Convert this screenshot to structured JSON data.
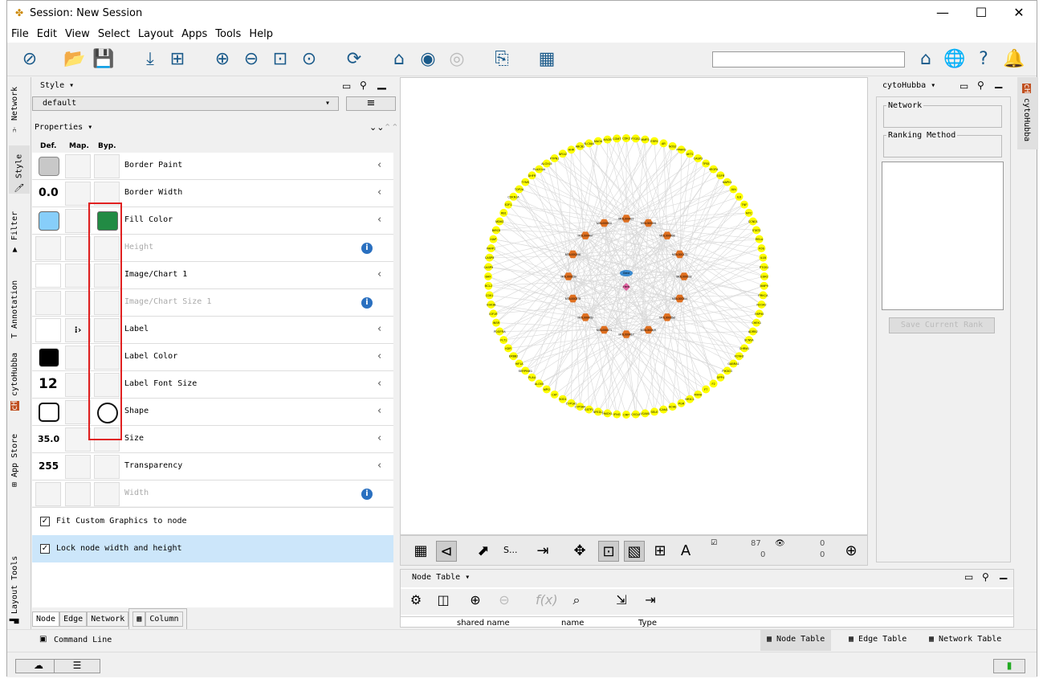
{
  "window": {
    "title": "Session: New Session",
    "min": "—",
    "max": "☐",
    "close": "✕"
  },
  "menu": [
    "File",
    "Edit",
    "View",
    "Select",
    "Layout",
    "Apps",
    "Tools",
    "Help"
  ],
  "left_tabs": [
    "Network",
    "Style",
    "Filter",
    "Annotation",
    "cytoHubba",
    "App Store",
    "Layout Tools"
  ],
  "style_panel": {
    "header": "Style",
    "style_name": "default",
    "properties_label": "Properties",
    "col_def": "Def.",
    "col_map": "Map.",
    "col_byp": "Byp.",
    "rows": [
      {
        "label": "Border Paint",
        "def": "",
        "disabled": false,
        "info": false
      },
      {
        "label": "Border Width",
        "def": "0.0",
        "disabled": false,
        "info": false
      },
      {
        "label": "Fill Color",
        "def": "",
        "disabled": false,
        "info": false
      },
      {
        "label": "Height",
        "def": "",
        "disabled": true,
        "info": true
      },
      {
        "label": "Image/Chart 1",
        "def": "",
        "disabled": false,
        "info": false
      },
      {
        "label": "Image/Chart Size 1",
        "def": "",
        "disabled": true,
        "info": true
      },
      {
        "label": "Label",
        "def": "",
        "disabled": false,
        "info": false
      },
      {
        "label": "Label Color",
        "def": "",
        "disabled": false,
        "info": false
      },
      {
        "label": "Label Font Size",
        "def": "12",
        "disabled": false,
        "info": false
      },
      {
        "label": "Shape",
        "def": "",
        "disabled": false,
        "info": false
      },
      {
        "label": "Size",
        "def": "35.0",
        "disabled": false,
        "info": false
      },
      {
        "label": "Transparency",
        "def": "255",
        "disabled": false,
        "info": false
      },
      {
        "label": "Width",
        "def": "",
        "disabled": true,
        "info": true
      }
    ],
    "fit_custom": "Fit Custom Graphics to node",
    "lock_node": "Lock node width and height",
    "tabs": [
      "Node",
      "Edge",
      "Network",
      "Column"
    ]
  },
  "colors": {
    "fill_default": "#87cefa",
    "fill_bypass": "#228b44",
    "border_default": "#c8c8c8",
    "outer_nodes": "#ffff00",
    "inner_nodes": "#e07020",
    "selection": "#e02020"
  },
  "canvas_bar": {
    "s_label": "S...",
    "selected_nodes": "87",
    "hidden_nodes": "0",
    "selected_edges": "0",
    "hidden_edges": "0"
  },
  "node_table": {
    "title": "Node Table",
    "col1": "shared name",
    "col2": "name",
    "col3": "Type"
  },
  "right_panel": {
    "title": "cytoHubba",
    "network_label": "Network",
    "ranking_label": "Ranking Method",
    "save_btn": "Save Current Rank",
    "tab": "cytoHubba"
  },
  "bottom_tabs": [
    "Node Table",
    "Edge Table",
    "Network Table"
  ],
  "command_line": "Command Line",
  "network": {
    "outer_labels": [
      "CDK2",
      "PTGS2",
      "MMP3",
      "ESR1",
      "AR",
      "NOS2",
      "PPARG",
      "AKT1",
      "CASP3",
      "TP53",
      "VEGFA",
      "EGFR",
      "MAPK1",
      "JUN",
      "IL6",
      "TNF",
      "MYC",
      "CCND1",
      "STAT3",
      "RELA",
      "FOS",
      "IL1B",
      "PTGS1",
      "ESR2",
      "MMP9",
      "PRKCA",
      "NCOA2",
      "HSP90",
      "CHEK1",
      "ADRB2",
      "SCN5A",
      "CHRM1",
      "KCNH2",
      "GABRA1",
      "PIK3CG",
      "DPP4",
      "F2",
      "F7",
      "RXRA",
      "NR3C1",
      "PGR",
      "ACHE",
      "ICAM1",
      "SELE",
      "VCAM1",
      "CXCL8",
      "CRP",
      "IFNG",
      "HMOX1",
      "NFE2L2",
      "GSTP1",
      "CYP3A4",
      "CYP1A1",
      "SOD1",
      "CAT",
      "MPO",
      "ALOX5",
      "PLAU",
      "SERPINE1",
      "HIF1A",
      "ERBB2",
      "KDR",
      "FLT1",
      "PDGFRA",
      "INSR",
      "IGF1R",
      "GSK3B",
      "CDK1",
      "BCL2",
      "BAX",
      "CASP9",
      "CASP8",
      "PARP1",
      "XIAP",
      "BIRC5",
      "MDM2",
      "RB1",
      "E2F1",
      "CDKN1A",
      "TOP2A",
      "TYMS",
      "DHFR",
      "PLA2G4A",
      "ALOX15",
      "PTPN1",
      "NR1I2",
      "AHR",
      "ABCB1",
      "SLC6A4",
      "MAOA",
      "MAOB",
      "COMT"
    ],
    "inner_labels": [
      "MOL000422",
      "MOL000006",
      "MOL000098",
      "MOL000173",
      "MOL000392",
      "MOL000354",
      "MOL000358",
      "MOL000449",
      "MOL000417",
      "MOL000471",
      "MOL000433",
      "MOL000378",
      "MOL000239",
      "MOL000296",
      "MOL000497",
      "MOL000500"
    ],
    "center_labels": [
      "Gene",
      "Herb"
    ]
  }
}
